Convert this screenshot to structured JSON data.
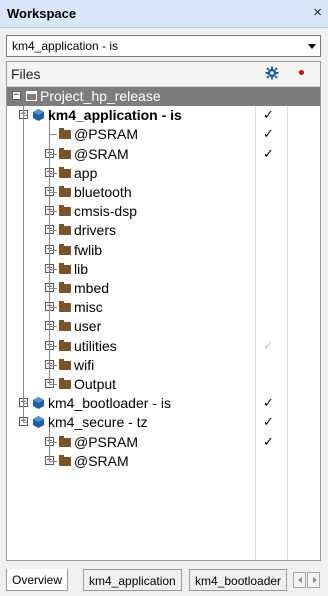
{
  "window": {
    "title": "Workspace",
    "close_glyph": "×"
  },
  "config": {
    "value": "km4_application - is"
  },
  "tree_header": {
    "files_label": "Files",
    "gear_icon": "gear-icon",
    "dot_icon": "red-dot-icon"
  },
  "tree": [
    {
      "label": "Project_hp_release",
      "type": "project",
      "expander": "minus",
      "check": "",
      "bold": false,
      "selected": true,
      "depth": 0
    },
    {
      "label": "km4_application - is",
      "type": "config",
      "expander": "minus",
      "check": "✓",
      "bold": true,
      "depth": 1
    },
    {
      "label": "@PSRAM",
      "type": "folder",
      "expander": "",
      "check": "✓",
      "depth": 2
    },
    {
      "label": "@SRAM",
      "type": "folder",
      "expander": "plus",
      "check": "✓",
      "depth": 2
    },
    {
      "label": "app",
      "type": "folder",
      "expander": "plus",
      "check": "",
      "depth": 2
    },
    {
      "label": "bluetooth",
      "type": "folder",
      "expander": "plus",
      "check": "",
      "depth": 2
    },
    {
      "label": "cmsis-dsp",
      "type": "folder",
      "expander": "plus",
      "check": "",
      "depth": 2
    },
    {
      "label": "drivers",
      "type": "folder",
      "expander": "plus",
      "check": "",
      "depth": 2
    },
    {
      "label": "fwlib",
      "type": "folder",
      "expander": "plus",
      "check": "",
      "depth": 2
    },
    {
      "label": "lib",
      "type": "folder",
      "expander": "plus",
      "check": "",
      "depth": 2
    },
    {
      "label": "mbed",
      "type": "folder",
      "expander": "plus",
      "check": "",
      "depth": 2
    },
    {
      "label": "misc",
      "type": "folder",
      "expander": "plus",
      "check": "",
      "depth": 2
    },
    {
      "label": "user",
      "type": "folder",
      "expander": "plus",
      "check": "",
      "depth": 2
    },
    {
      "label": "utilities",
      "type": "folder",
      "expander": "plus",
      "check": "✓",
      "check_faint": true,
      "depth": 2
    },
    {
      "label": "wifi",
      "type": "folder",
      "expander": "plus",
      "check": "",
      "depth": 2
    },
    {
      "label": "Output",
      "type": "folder",
      "expander": "plus",
      "check": "",
      "depth": 2
    },
    {
      "label": "km4_bootloader - is",
      "type": "config",
      "expander": "plus",
      "check": "✓",
      "depth": 1
    },
    {
      "label": "km4_secure - tz",
      "type": "config",
      "expander": "minus",
      "check": "✓",
      "depth": 1
    },
    {
      "label": "@PSRAM",
      "type": "folder",
      "expander": "plus",
      "check": "✓",
      "depth": 2
    },
    {
      "label": "@SRAM",
      "type": "folder",
      "expander": "plus",
      "check": "",
      "depth": 2
    }
  ],
  "tabs": [
    {
      "label": "Overview",
      "active": true
    },
    {
      "label": "km4_application",
      "active": false
    },
    {
      "label": "km4_bootloader",
      "active": false
    }
  ],
  "colors": {
    "folder": "#7a5426",
    "config_icon": "#1f5fa8",
    "selected_row": "#7d7d7d",
    "titlebar": "#d9e6f7"
  }
}
